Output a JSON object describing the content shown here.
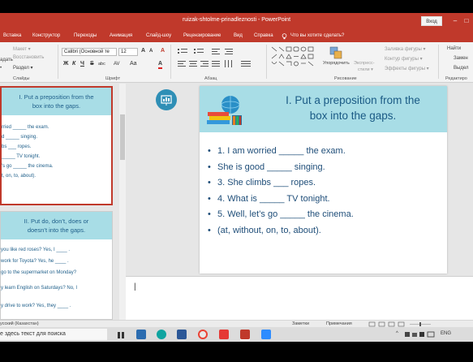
{
  "window": {
    "title": "ruizak-shtolme-prinadleznosti - PowerPoint",
    "signin_label": "Вход",
    "minimize": "–",
    "maximize": "□"
  },
  "ribbon_tabs": [
    "Вставка",
    "Конструктор",
    "Переходы",
    "Анимация",
    "Слайд-шоу",
    "Рецензирование",
    "Вид",
    "Справка"
  ],
  "tell_me": "Что вы хотите сделать?",
  "ribbon": {
    "clipboard": {
      "left_top": "адать",
      "left_mid": "•",
      "items": [
        "Макет ▾",
        "Восстановить",
        "Раздел ▾"
      ],
      "label": "Слайды"
    },
    "font": {
      "name": "Calibri (Основной те",
      "size": "12",
      "grow": "A",
      "shrink": "A",
      "clear": "A",
      "bold": "Ж",
      "italic": "К",
      "underline": "Ч",
      "strike": "S",
      "shadow": "abc",
      "spacing": "AV",
      "case": "Aa",
      "color": "A",
      "label": "Шрифт"
    },
    "paragraph": {
      "label": "Абзац"
    },
    "drawing": {
      "arrange": "Упорядочить",
      "quick_styles_1": "Экспресс-",
      "quick_styles_2": "стили ▾",
      "fill": "Заливка фигуры ▾",
      "outline": "Контур фигуры ▾",
      "effects": "Эффекты фигуры ▾",
      "label": "Рисование"
    },
    "editing": {
      "find": "Найти",
      "replace": "Замен",
      "select": "Выдел",
      "label": "Редактиро"
    }
  },
  "thumbnails": [
    {
      "title": [
        "I. Put a preposition from the",
        "box into the gaps."
      ],
      "lines": [
        "rried _____ the exam.",
        "d _____ singing.",
        "bs ___ ropes.",
        "_____ TV tonight.",
        "'s go _____ the cinema.",
        "t, on, to, about)."
      ]
    },
    {
      "title": [
        "II. Put do, don’t, does or",
        "doesn’t into the gaps."
      ],
      "lines": [
        "you like red roses? Yes, I ____ .",
        "work for Toyota? Yes, he ____ .",
        "go to the supermarket on Monday?",
        "y learn English on Saturdays? No, I",
        "y drive to work? Yes, they ____ ."
      ]
    }
  ],
  "slide": {
    "title_line1": "I. Put a preposition from the",
    "title_line2": "box into the gaps.",
    "bullets": [
      "1. I am worried _____ the exam.",
      "She is good _____ singing.",
      "3. She climbs ___ ropes.",
      "4. What is _____ TV tonight.",
      "5. Well, let’s go _____ the cinema.",
      "(at, without, on, to, about)."
    ]
  },
  "status": {
    "language": "усский (Казахстан)",
    "notes": "Заметки",
    "comments": "Примечания"
  },
  "taskbar": {
    "search_placeholder": "е здесь текст для поиска",
    "lang": "ENG",
    "chevron": "^"
  },
  "colors": {
    "accent": "#c0392b",
    "slide_header": "#a8dde6",
    "slide_text": "#1f4e79"
  }
}
